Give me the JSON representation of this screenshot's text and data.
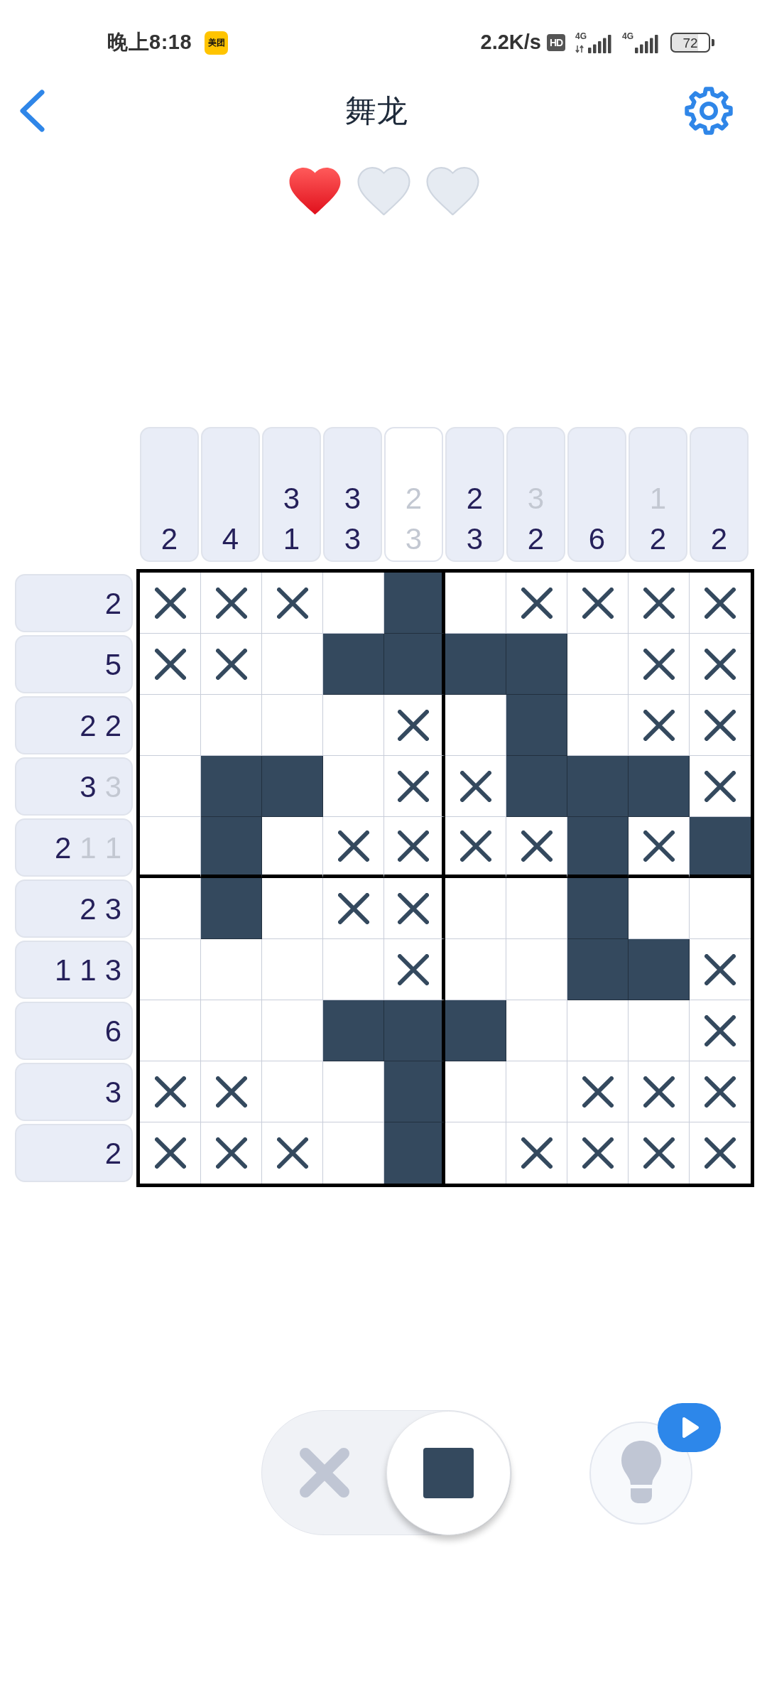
{
  "status_bar": {
    "time": "晚上8:18",
    "app_badge": "美团",
    "net_speed": "2.2K/s",
    "hd_badge": "HD",
    "signals": [
      {
        "label": "4G",
        "data_activity": true
      },
      {
        "label": "4G",
        "data_activity": false
      }
    ],
    "battery": "72"
  },
  "header": {
    "title": "舞龙"
  },
  "lives": [
    {
      "filled": true
    },
    {
      "filled": false
    },
    {
      "filled": false
    }
  ],
  "column_clues": [
    {
      "complete": false,
      "numbers": [
        {
          "value": "2",
          "done": false
        }
      ]
    },
    {
      "complete": false,
      "numbers": [
        {
          "value": "4",
          "done": false
        }
      ]
    },
    {
      "complete": false,
      "numbers": [
        {
          "value": "3",
          "done": false
        },
        {
          "value": "1",
          "done": false
        }
      ]
    },
    {
      "complete": false,
      "numbers": [
        {
          "value": "3",
          "done": false
        },
        {
          "value": "3",
          "done": false
        }
      ]
    },
    {
      "complete": true,
      "numbers": [
        {
          "value": "2",
          "done": true
        },
        {
          "value": "3",
          "done": true
        }
      ]
    },
    {
      "complete": false,
      "numbers": [
        {
          "value": "2",
          "done": false
        },
        {
          "value": "3",
          "done": false
        }
      ]
    },
    {
      "complete": false,
      "numbers": [
        {
          "value": "3",
          "done": true
        },
        {
          "value": "2",
          "done": false
        }
      ]
    },
    {
      "complete": false,
      "numbers": [
        {
          "value": "6",
          "done": false
        }
      ]
    },
    {
      "complete": false,
      "numbers": [
        {
          "value": "1",
          "done": true
        },
        {
          "value": "2",
          "done": false
        }
      ]
    },
    {
      "complete": false,
      "numbers": [
        {
          "value": "2",
          "done": false
        }
      ]
    }
  ],
  "row_clues": [
    {
      "complete": false,
      "numbers": [
        {
          "value": "2",
          "done": false
        }
      ]
    },
    {
      "complete": false,
      "numbers": [
        {
          "value": "5",
          "done": false
        }
      ]
    },
    {
      "complete": false,
      "numbers": [
        {
          "value": "2",
          "done": false
        },
        {
          "value": "2",
          "done": false
        }
      ]
    },
    {
      "complete": false,
      "numbers": [
        {
          "value": "3",
          "done": false
        },
        {
          "value": "3",
          "done": true
        }
      ]
    },
    {
      "complete": false,
      "numbers": [
        {
          "value": "2",
          "done": false
        },
        {
          "value": "1",
          "done": true
        },
        {
          "value": "1",
          "done": true
        }
      ]
    },
    {
      "complete": false,
      "numbers": [
        {
          "value": "2",
          "done": false
        },
        {
          "value": "3",
          "done": false
        }
      ]
    },
    {
      "complete": false,
      "numbers": [
        {
          "value": "1",
          "done": false
        },
        {
          "value": "1",
          "done": false
        },
        {
          "value": "3",
          "done": false
        }
      ]
    },
    {
      "complete": false,
      "numbers": [
        {
          "value": "6",
          "done": false
        }
      ]
    },
    {
      "complete": false,
      "numbers": [
        {
          "value": "3",
          "done": false
        }
      ]
    },
    {
      "complete": false,
      "numbers": [
        {
          "value": "2",
          "done": false
        }
      ]
    }
  ],
  "grid": {
    "rows": [
      {
        "cells": [
          {
            "filled": false,
            "crossed": true
          },
          {
            "filled": false,
            "crossed": true
          },
          {
            "filled": false,
            "crossed": true
          },
          {
            "filled": false,
            "crossed": false
          },
          {
            "filled": true,
            "crossed": false
          },
          {
            "filled": false,
            "crossed": false
          },
          {
            "filled": false,
            "crossed": true
          },
          {
            "filled": false,
            "crossed": true
          },
          {
            "filled": false,
            "crossed": true
          },
          {
            "filled": false,
            "crossed": true
          }
        ]
      },
      {
        "cells": [
          {
            "filled": false,
            "crossed": true
          },
          {
            "filled": false,
            "crossed": true
          },
          {
            "filled": false,
            "crossed": false
          },
          {
            "filled": true,
            "crossed": false
          },
          {
            "filled": true,
            "crossed": false
          },
          {
            "filled": true,
            "crossed": false
          },
          {
            "filled": true,
            "crossed": false
          },
          {
            "filled": false,
            "crossed": false
          },
          {
            "filled": false,
            "crossed": true
          },
          {
            "filled": false,
            "crossed": true
          }
        ]
      },
      {
        "cells": [
          {
            "filled": false,
            "crossed": false
          },
          {
            "filled": false,
            "crossed": false
          },
          {
            "filled": false,
            "crossed": false
          },
          {
            "filled": false,
            "crossed": false
          },
          {
            "filled": false,
            "crossed": true
          },
          {
            "filled": false,
            "crossed": false
          },
          {
            "filled": true,
            "crossed": false
          },
          {
            "filled": false,
            "crossed": false
          },
          {
            "filled": false,
            "crossed": true
          },
          {
            "filled": false,
            "crossed": true
          }
        ]
      },
      {
        "cells": [
          {
            "filled": false,
            "crossed": false
          },
          {
            "filled": true,
            "crossed": false
          },
          {
            "filled": true,
            "crossed": false
          },
          {
            "filled": false,
            "crossed": false
          },
          {
            "filled": false,
            "crossed": true
          },
          {
            "filled": false,
            "crossed": true
          },
          {
            "filled": true,
            "crossed": false
          },
          {
            "filled": true,
            "crossed": false
          },
          {
            "filled": true,
            "crossed": false
          },
          {
            "filled": false,
            "crossed": true
          }
        ]
      },
      {
        "cells": [
          {
            "filled": false,
            "crossed": false
          },
          {
            "filled": true,
            "crossed": false
          },
          {
            "filled": false,
            "crossed": false
          },
          {
            "filled": false,
            "crossed": true
          },
          {
            "filled": false,
            "crossed": true
          },
          {
            "filled": false,
            "crossed": true
          },
          {
            "filled": false,
            "crossed": true
          },
          {
            "filled": true,
            "crossed": false
          },
          {
            "filled": false,
            "crossed": true
          },
          {
            "filled": true,
            "crossed": false
          }
        ]
      },
      {
        "cells": [
          {
            "filled": false,
            "crossed": false
          },
          {
            "filled": true,
            "crossed": false
          },
          {
            "filled": false,
            "crossed": false
          },
          {
            "filled": false,
            "crossed": true
          },
          {
            "filled": false,
            "crossed": true
          },
          {
            "filled": false,
            "crossed": false
          },
          {
            "filled": false,
            "crossed": false
          },
          {
            "filled": true,
            "crossed": false
          },
          {
            "filled": false,
            "crossed": false
          },
          {
            "filled": false,
            "crossed": false
          }
        ]
      },
      {
        "cells": [
          {
            "filled": false,
            "crossed": false
          },
          {
            "filled": false,
            "crossed": false
          },
          {
            "filled": false,
            "crossed": false
          },
          {
            "filled": false,
            "crossed": false
          },
          {
            "filled": false,
            "crossed": true
          },
          {
            "filled": false,
            "crossed": false
          },
          {
            "filled": false,
            "crossed": false
          },
          {
            "filled": true,
            "crossed": false
          },
          {
            "filled": true,
            "crossed": false
          },
          {
            "filled": false,
            "crossed": true
          }
        ]
      },
      {
        "cells": [
          {
            "filled": false,
            "crossed": false
          },
          {
            "filled": false,
            "crossed": false
          },
          {
            "filled": false,
            "crossed": false
          },
          {
            "filled": true,
            "crossed": false
          },
          {
            "filled": true,
            "crossed": false
          },
          {
            "filled": true,
            "crossed": false
          },
          {
            "filled": false,
            "crossed": false
          },
          {
            "filled": false,
            "crossed": false
          },
          {
            "filled": false,
            "crossed": false
          },
          {
            "filled": false,
            "crossed": true
          }
        ]
      },
      {
        "cells": [
          {
            "filled": false,
            "crossed": true
          },
          {
            "filled": false,
            "crossed": true
          },
          {
            "filled": false,
            "crossed": false
          },
          {
            "filled": false,
            "crossed": false
          },
          {
            "filled": true,
            "crossed": false
          },
          {
            "filled": false,
            "crossed": false
          },
          {
            "filled": false,
            "crossed": false
          },
          {
            "filled": false,
            "crossed": true
          },
          {
            "filled": false,
            "crossed": true
          },
          {
            "filled": false,
            "crossed": true
          }
        ]
      },
      {
        "cells": [
          {
            "filled": false,
            "crossed": true
          },
          {
            "filled": false,
            "crossed": true
          },
          {
            "filled": false,
            "crossed": true
          },
          {
            "filled": false,
            "crossed": false
          },
          {
            "filled": true,
            "crossed": false
          },
          {
            "filled": false,
            "crossed": false
          },
          {
            "filled": false,
            "crossed": true
          },
          {
            "filled": false,
            "crossed": true
          },
          {
            "filled": false,
            "crossed": true
          },
          {
            "filled": false,
            "crossed": true
          }
        ]
      }
    ]
  },
  "mode_toggle": {
    "options": [
      {
        "kind": "cross",
        "selected": false
      },
      {
        "kind": "fill",
        "selected": true
      }
    ]
  }
}
